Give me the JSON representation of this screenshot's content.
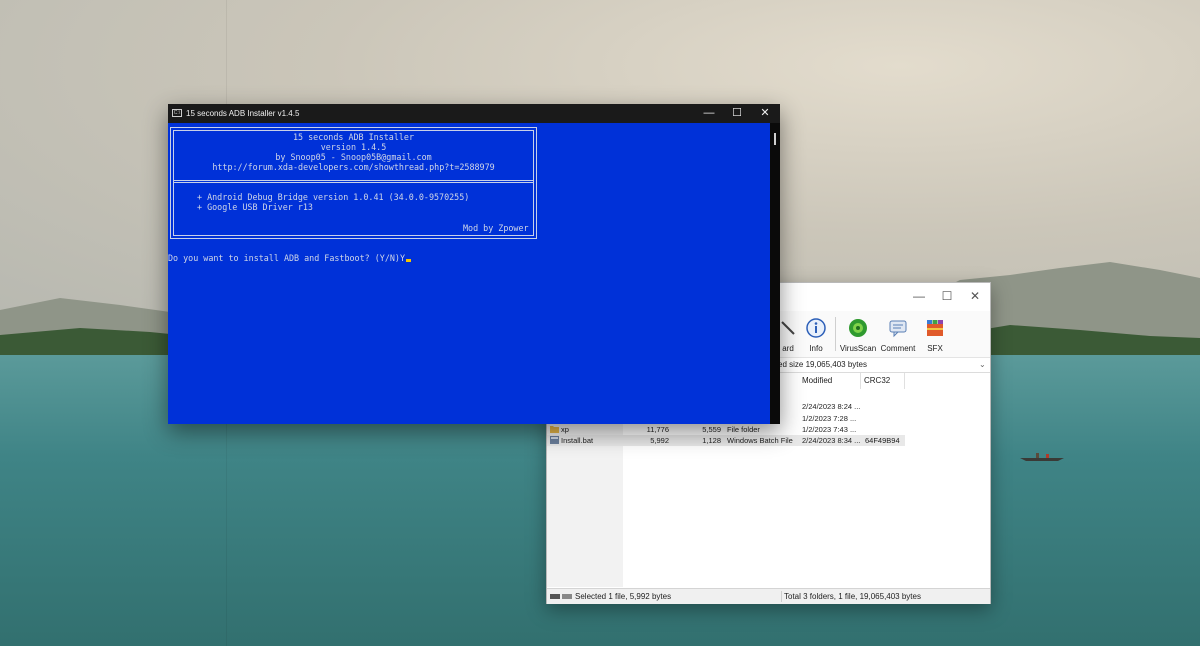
{
  "console": {
    "title": "15 seconds ADB Installer v1.4.5",
    "app_icon_text": "C:\\",
    "minimize": "—",
    "maximize": "☐",
    "close": "✕",
    "banner": {
      "name": "15 seconds ADB Installer",
      "version": "version 1.4.5",
      "author": "by Snoop05 - Snoop05B@gmail.com",
      "url": "http://forum.xda-developers.com/showthread.php?t=2588979",
      "item1": "+ Android Debug Bridge version 1.0.41 (34.0.0-9570255)",
      "item2": "+ Google USB Driver r13",
      "mod": "Mod by Zpower"
    },
    "prompt": "Do you want to install ADB and Fastboot? (Y/N)Y"
  },
  "archive": {
    "window_controls": {
      "minimize": "—",
      "maximize": "☐",
      "close": "✕"
    },
    "toolbar": {
      "wizard_label": "ard",
      "info_label": "Info",
      "virusscan_label": "VirusScan",
      "comment_label": "Comment",
      "sfx_label": "SFX"
    },
    "path_text": "ked size 19,065,403 bytes",
    "columns": {
      "modified": "Modified",
      "crc": "CRC32"
    },
    "rows": [
      {
        "name": "",
        "size": "",
        "packed": "",
        "type": "",
        "modified": "2/24/2023 8:24 ...",
        "crc": ""
      },
      {
        "name": "",
        "size": "",
        "packed": "",
        "type": "",
        "modified": "1/2/2023 7:28 ...",
        "crc": ""
      },
      {
        "name": "xp",
        "size": "11,776",
        "packed": "5,559",
        "type": "File folder",
        "modified": "1/2/2023 7:43 ...",
        "crc": ""
      },
      {
        "name": "Install.bat",
        "size": "5,992",
        "packed": "1,128",
        "type": "Windows Batch File",
        "modified": "2/24/2023 8:34 ...",
        "crc": "64F49B94"
      }
    ],
    "status_left": "Selected 1 file, 5,992 bytes",
    "status_right": "Total 3 folders, 1 file, 19,065,403 bytes"
  }
}
